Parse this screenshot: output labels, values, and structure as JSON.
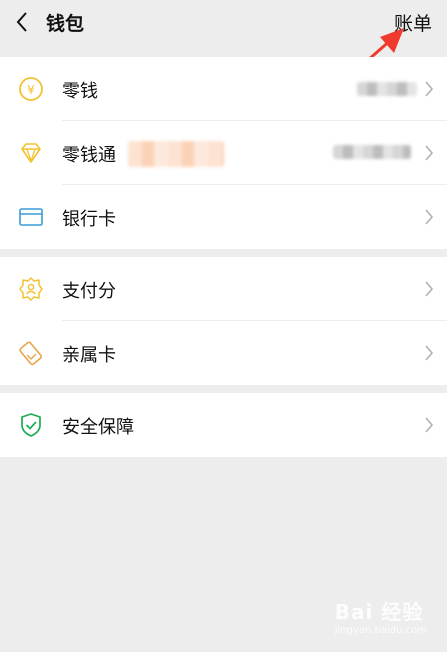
{
  "header": {
    "title": "钱包",
    "bill_label": "账单"
  },
  "groups": [
    {
      "items": [
        {
          "label": "零钱",
          "icon": "yuan-coin-icon"
        },
        {
          "label": "零钱通",
          "icon": "diamond-icon"
        },
        {
          "label": "银行卡",
          "icon": "bank-card-icon"
        }
      ]
    },
    {
      "items": [
        {
          "label": "支付分",
          "icon": "pay-score-icon"
        },
        {
          "label": "亲属卡",
          "icon": "family-card-icon"
        }
      ]
    },
    {
      "items": [
        {
          "label": "安全保障",
          "icon": "shield-check-icon"
        }
      ]
    }
  ],
  "colors": {
    "background": "#ededed",
    "icon_yellow": "#f2c230",
    "icon_blue": "#3a9bd9",
    "icon_orange": "#e8a54b",
    "icon_green": "#1aad52",
    "arrow_red": "#f03a2e"
  },
  "watermark": {
    "text": "Bai 经验",
    "sub": "jingyan.baidu.com"
  }
}
